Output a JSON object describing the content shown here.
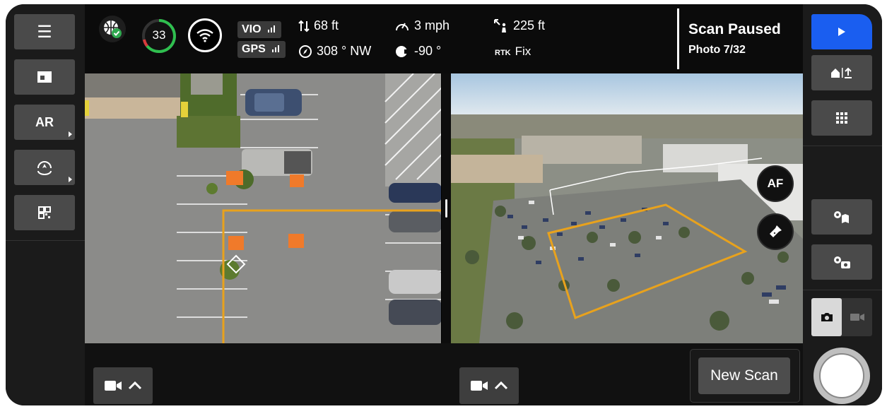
{
  "left_sidebar": {
    "items": [
      {
        "name": "menu-icon",
        "label": "☰"
      },
      {
        "name": "layout-icon",
        "label": ""
      },
      {
        "name": "ar",
        "label": "AR"
      },
      {
        "name": "orbit-icon",
        "label": ""
      },
      {
        "name": "qr-icon",
        "label": ""
      }
    ]
  },
  "status": {
    "satellite_count": "33",
    "vio_label": "VIO",
    "gps_label": "GPS",
    "altitude": "68 ft",
    "heading": "308 ° NW",
    "speed": "3 mph",
    "gimbal": "-90 °",
    "distance": "225 ft",
    "rtk_label": "RTK",
    "rtk_status": "Fix"
  },
  "scan": {
    "title": "Scan Paused",
    "progress": "Photo 7/32"
  },
  "camera_overlay": {
    "af_label": "AF"
  },
  "bottom": {
    "new_scan_label": "New Scan"
  },
  "colors": {
    "accent_blue": "#1a5ef0",
    "scan_outline": "#e8a21d",
    "marker_orange": "#f07a2a",
    "panel_bg": "#1b1b1b",
    "button_bg": "#4a4a4a"
  }
}
